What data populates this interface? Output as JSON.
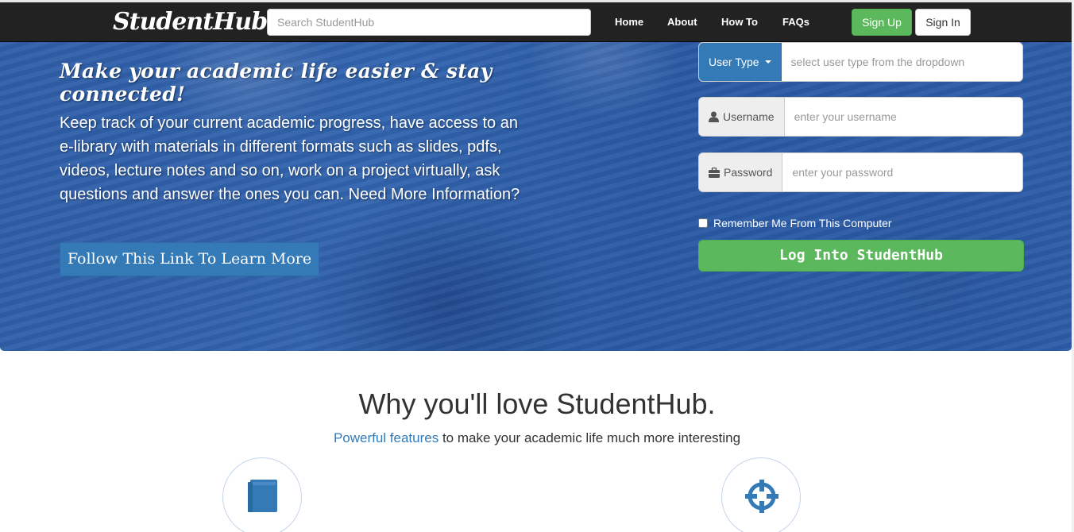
{
  "navbar": {
    "brand_main": "Student",
    "brand_hub": "Hub",
    "search_placeholder": "Search StudentHub",
    "links": [
      "Home",
      "About",
      "How To",
      "FAQs"
    ],
    "signup_label": "Sign Up",
    "signin_label": "Sign In"
  },
  "hero": {
    "tagline": "Make your academic life easier & stay connected!",
    "description": "Keep track of your current academic progress, have access to an e-library with materials in different formats such as slides, pdfs, videos, lecture notes and so on, work on a project virtually, ask questions and answer the ones you can. Need More Information?",
    "learn_more_label": "Follow This Link To Learn More"
  },
  "login": {
    "user_type_label": "User Type",
    "user_type_placeholder": "select user type from the dropdown",
    "username_label": "Username",
    "username_placeholder": "enter your username",
    "password_label": "Password",
    "password_placeholder": "enter your password",
    "remember_label": "Remember Me From This Computer",
    "submit_label": "Log Into StudentHub"
  },
  "features": {
    "title": "Why you'll love StudentHub.",
    "subtitle_highlight": "Powerful features",
    "subtitle_rest": " to make your academic life much more interesting",
    "icons": [
      "book-icon",
      "crosshair-icon"
    ]
  },
  "colors": {
    "navbar": "#222222",
    "primary": "#337ab7",
    "success": "#5cb85c",
    "hero": "#2f5ea8"
  }
}
